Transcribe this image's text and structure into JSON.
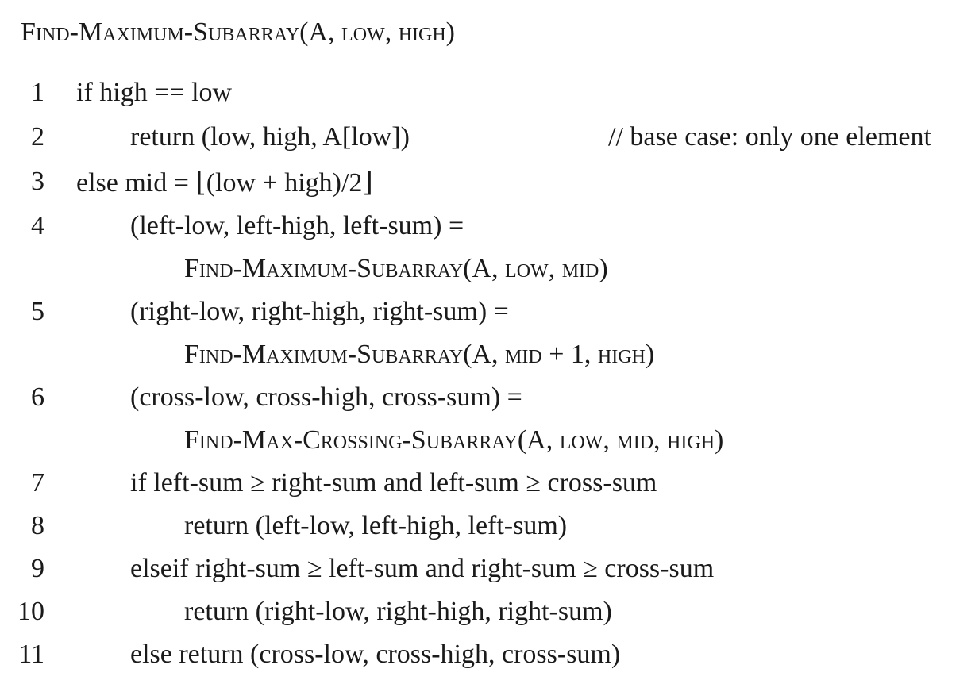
{
  "header": {
    "text": "Find-Maximum-Subarray(A, low, high)"
  },
  "lines": [
    {
      "number": "1",
      "text": "if high == low"
    },
    {
      "number": "2",
      "text": "return (low, high, A[low])",
      "comment": "// base case: only one element"
    },
    {
      "number": "3",
      "text": "else mid = ⌊(low + high)/2⌋"
    },
    {
      "number": "4",
      "text": "(left-low, left-high, left-sum) ="
    },
    {
      "number": "",
      "text": "Find-Maximum-Subarray(A, low, mid)"
    },
    {
      "number": "5",
      "text": "(right-low, right-high, right-sum) ="
    },
    {
      "number": "",
      "text": "Find-Maximum-Subarray(A, mid + 1, high)"
    },
    {
      "number": "6",
      "text": "(cross-low, cross-high, cross-sum) ="
    },
    {
      "number": "",
      "text": "Find-Max-Crossing-Subarray(A, low, mid, high)"
    },
    {
      "number": "7",
      "text": "if left-sum ≥ right-sum and left-sum ≥ cross-sum"
    },
    {
      "number": "8",
      "text": "return (left-low, left-high, left-sum)"
    },
    {
      "number": "9",
      "text": "elseif right-sum ≥ left-sum and right-sum ≥ cross-sum"
    },
    {
      "number": "10",
      "text": "return (right-low, right-high, right-sum)"
    },
    {
      "number": "11",
      "text": "else return (cross-low, cross-high, cross-sum)"
    }
  ]
}
